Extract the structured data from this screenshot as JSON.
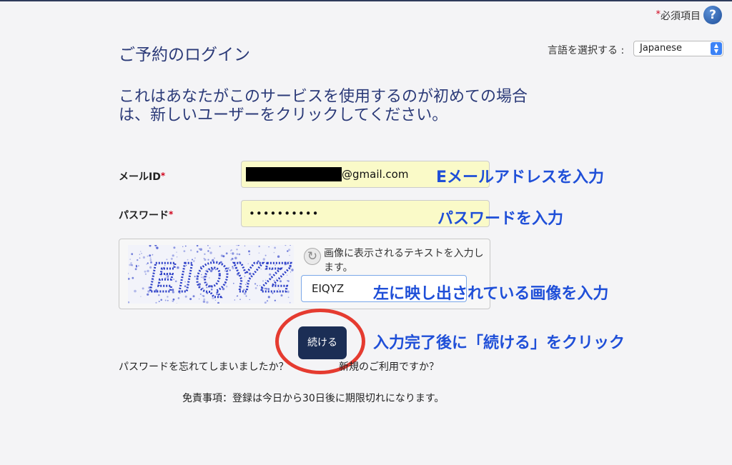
{
  "header": {
    "required_star": "*",
    "required_label": "必須項目",
    "help_glyph": "?",
    "title": "ご予約のログイン"
  },
  "language": {
    "label": "言語を選択する :",
    "selected": "Japanese"
  },
  "intro": "これはあなたがこのサービスを使用するのが初めての場合は、新しいユーザーをクリックしてください。",
  "form": {
    "email_label": "メールID",
    "email_value_suffix": "@gmail.com",
    "password_label": "パスワード",
    "password_value": "••••••••••",
    "required_star": "*",
    "captcha_text": "EIQYZ",
    "captcha_hint": "画像に表示されるテキストを入力します。",
    "captcha_value": "EIQYZ",
    "continue_label": "続ける"
  },
  "annotations": {
    "email": "Eメールアドレスを入力",
    "password": "パスワードを入力",
    "captcha": "左に映し出されている画像を入力",
    "continue": "入力完了後に「続ける」をクリック"
  },
  "links": {
    "forgot_password": "パスワードを忘れてしまいましたか？",
    "new_user": "新規のご利用ですか？"
  },
  "disclaimer": "免責事項：登録は今日から30日後に期限切れになります。",
  "colors": {
    "title": "#2b3a78",
    "annotation": "#1f4fd8",
    "button": "#1b2e55",
    "highlight_circle": "#e53b30",
    "input_fill": "#fafac8"
  }
}
